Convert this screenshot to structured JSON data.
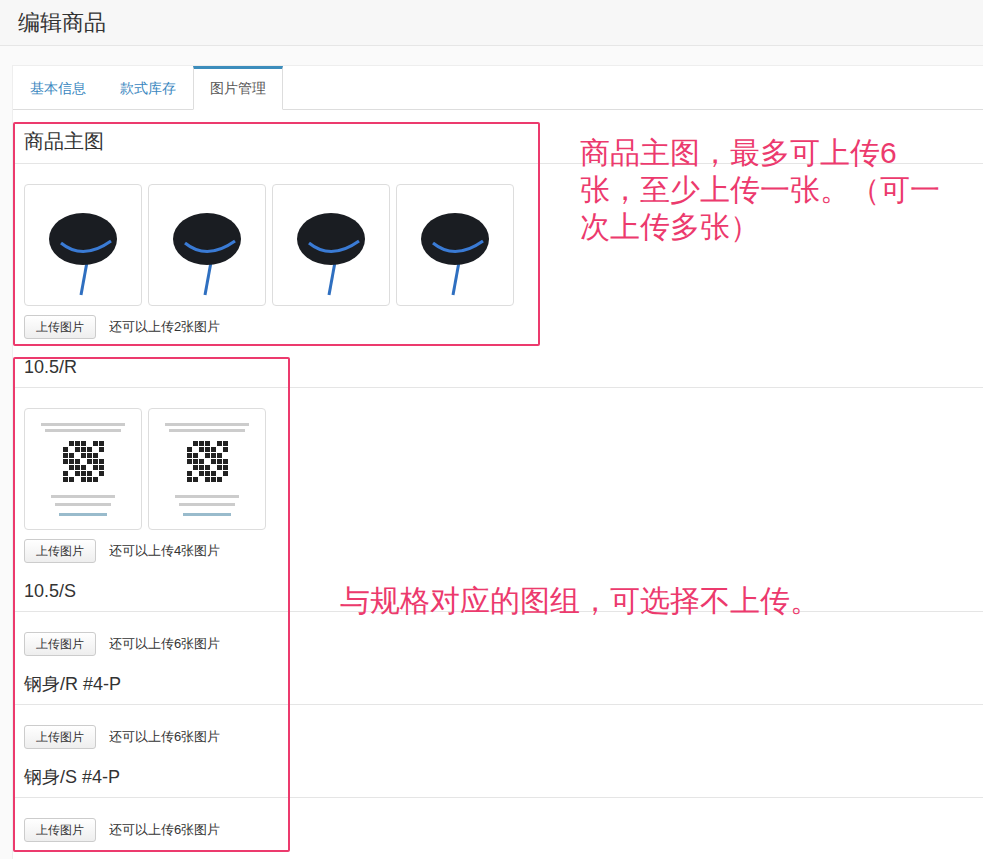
{
  "header": {
    "title": "编辑商品"
  },
  "tabs": [
    {
      "label": "基本信息",
      "selected": false
    },
    {
      "label": "款式库存",
      "selected": false
    },
    {
      "label": "图片管理",
      "selected": true
    }
  ],
  "main_images": {
    "title": "商品主图",
    "thumbnails": [
      {
        "kind": "photo"
      },
      {
        "kind": "photo"
      },
      {
        "kind": "photo"
      },
      {
        "kind": "photo"
      }
    ],
    "upload_button": "上传图片",
    "hint": "还可以上传2张图片"
  },
  "spec_groups": [
    {
      "title": "10.5/R",
      "thumbnails": [
        {
          "kind": "document"
        },
        {
          "kind": "document"
        }
      ],
      "upload_button": "上传图片",
      "hint": "还可以上传4张图片"
    },
    {
      "title": "10.5/S",
      "thumbnails": [],
      "upload_button": "上传图片",
      "hint": "还可以上传6张图片"
    },
    {
      "title": "钢身/R #4-P",
      "thumbnails": [],
      "upload_button": "上传图片",
      "hint": "还可以上传6张图片"
    },
    {
      "title": "钢身/S #4-P",
      "thumbnails": [],
      "upload_button": "上传图片",
      "hint": "还可以上传6张图片"
    }
  ],
  "annotations": [
    {
      "target": "main_images",
      "text": "商品主图，最多可上传6张，至少上传一张。（可一次上传多张）"
    },
    {
      "target": "spec_groups",
      "text": "与规格对应的图组，可选择不上传。"
    }
  ]
}
